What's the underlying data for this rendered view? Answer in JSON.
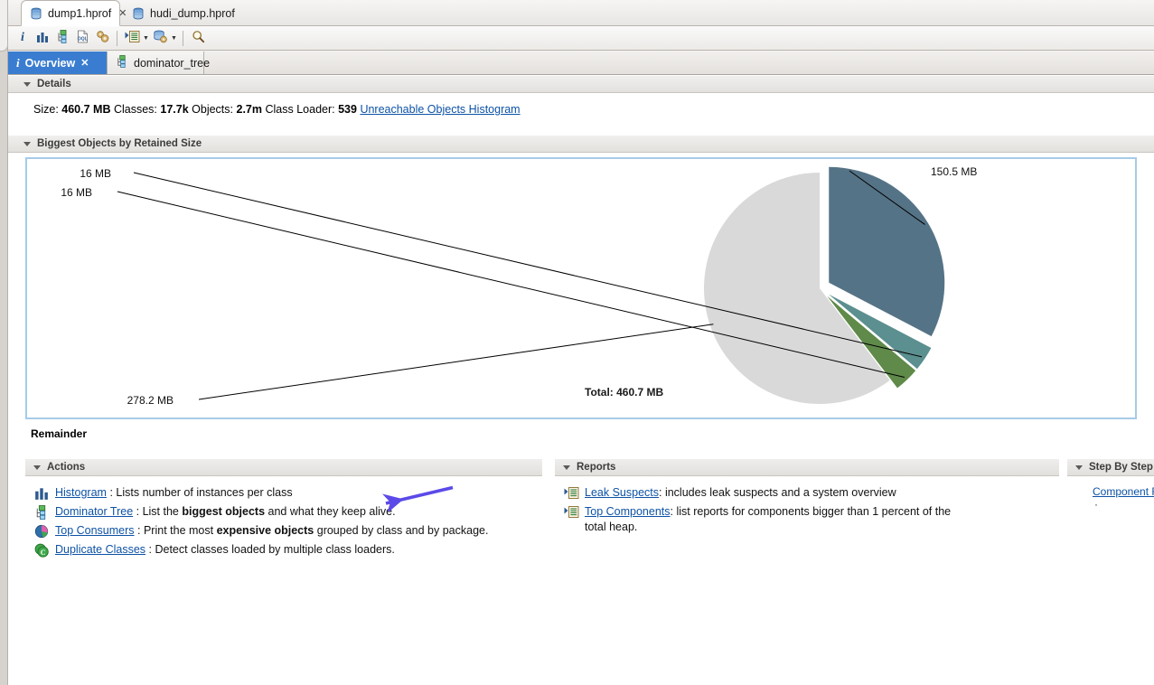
{
  "window": {
    "editor_tabs": [
      {
        "label": "dump1.hprof",
        "icon": "heap-dump-icon",
        "active": true,
        "close": "✕"
      },
      {
        "label": "hudi_dump.hprof",
        "icon": "heap-dump-icon",
        "active": false
      }
    ]
  },
  "toolbar": {
    "buttons": [
      {
        "name": "overview-info-button",
        "icon": "info-icon",
        "label": "i"
      },
      {
        "name": "histogram-button",
        "icon": "histogram-icon"
      },
      {
        "name": "dominator-tree-button",
        "icon": "dominator-tree-icon"
      },
      {
        "name": "oql-button",
        "icon": "oql-icon"
      },
      {
        "name": "thread-overview-button",
        "icon": "gears-icon"
      },
      {
        "name": "run-expert-system-button",
        "icon": "run-report-icon",
        "has_caret": true
      },
      {
        "name": "query-browser-button",
        "icon": "query-browser-icon",
        "has_caret": true
      },
      {
        "name": "search-button",
        "icon": "search-icon"
      }
    ]
  },
  "view_tabs": [
    {
      "label": "Overview",
      "icon": "info-icon",
      "active": true,
      "close": "✕"
    },
    {
      "label": "dominator_tree",
      "icon": "dominator-tree-icon",
      "active": false
    }
  ],
  "details": {
    "section_title": "Details",
    "size_label": "Size:",
    "size_value": "460.7 MB",
    "classes_label": "Classes:",
    "classes_value": "17.7k",
    "objects_label": "Objects:",
    "objects_value": "2.7m",
    "class_loader_label": "Class Loader:",
    "class_loader_value": "539",
    "unreachable_link": "Unreachable Objects Histogram"
  },
  "biggest_objects": {
    "section_title": "Biggest Objects by Retained Size",
    "total_label": "Total: 460.7 MB",
    "remainder_label": "Remainder"
  },
  "chart_data": {
    "type": "pie",
    "title": "Biggest Objects by Retained Size",
    "total": "460.7 MB",
    "total_value": 460.7,
    "unit": "MB",
    "legend_position": "none",
    "labels": [
      "150.5 MB",
      "16 MB",
      "16 MB",
      "278.2 MB"
    ],
    "values": [
      150.5,
      16,
      16,
      278.2
    ],
    "colors": [
      "#557386",
      "#5c8f8f",
      "#5f8a4a",
      "#d9d9d9"
    ],
    "exploded": [
      true,
      true,
      true,
      false
    ],
    "slices": [
      {
        "label": "150.5 MB",
        "value": 150.5,
        "color": "#557386",
        "exploded": true
      },
      {
        "label": "16 MB",
        "value": 16,
        "color": "#5c8f8f",
        "exploded": true
      },
      {
        "label": "16 MB",
        "value": 16,
        "color": "#5f8a4a",
        "exploded": true
      },
      {
        "label": "278.2 MB",
        "value": 278.2,
        "color": "#d9d9d9",
        "exploded": false
      }
    ]
  },
  "actions": {
    "section_title": "Actions",
    "items": [
      {
        "icon": "histogram-icon",
        "link": "Histogram",
        "sep": " : ",
        "desc_pre": "Lists number of instances per class",
        "desc_strong": "",
        "desc_post": ""
      },
      {
        "icon": "dominator-tree-icon",
        "link": "Dominator Tree",
        "sep": " : ",
        "desc_pre": "List the ",
        "desc_strong": "biggest objects",
        "desc_post": " and what they keep alive."
      },
      {
        "icon": "top-consumers-icon",
        "link": "Top Consumers",
        "sep": " : ",
        "desc_pre": "Print the most ",
        "desc_strong": "expensive objects",
        "desc_post": " grouped by class and by package."
      },
      {
        "icon": "duplicate-classes-icon",
        "link": "Duplicate Classes",
        "sep": " : ",
        "desc_pre": "Detect classes loaded by multiple class loaders.",
        "desc_strong": "",
        "desc_post": ""
      }
    ]
  },
  "reports": {
    "section_title": "Reports",
    "items": [
      {
        "icon": "run-report-icon",
        "link": "Leak Suspects",
        "sep": ": ",
        "desc_pre": "includes leak suspects and a system overview",
        "desc_strong": "",
        "desc_post": ""
      },
      {
        "icon": "run-report-icon",
        "link": "Top Components",
        "sep": ": ",
        "desc_pre": "list reports for components bigger than 1 percent of the total heap.",
        "desc_strong": "",
        "desc_post": ""
      }
    ]
  },
  "step_by_step": {
    "section_title": "Step By Step",
    "link": "Component R",
    "bullet": "·"
  }
}
